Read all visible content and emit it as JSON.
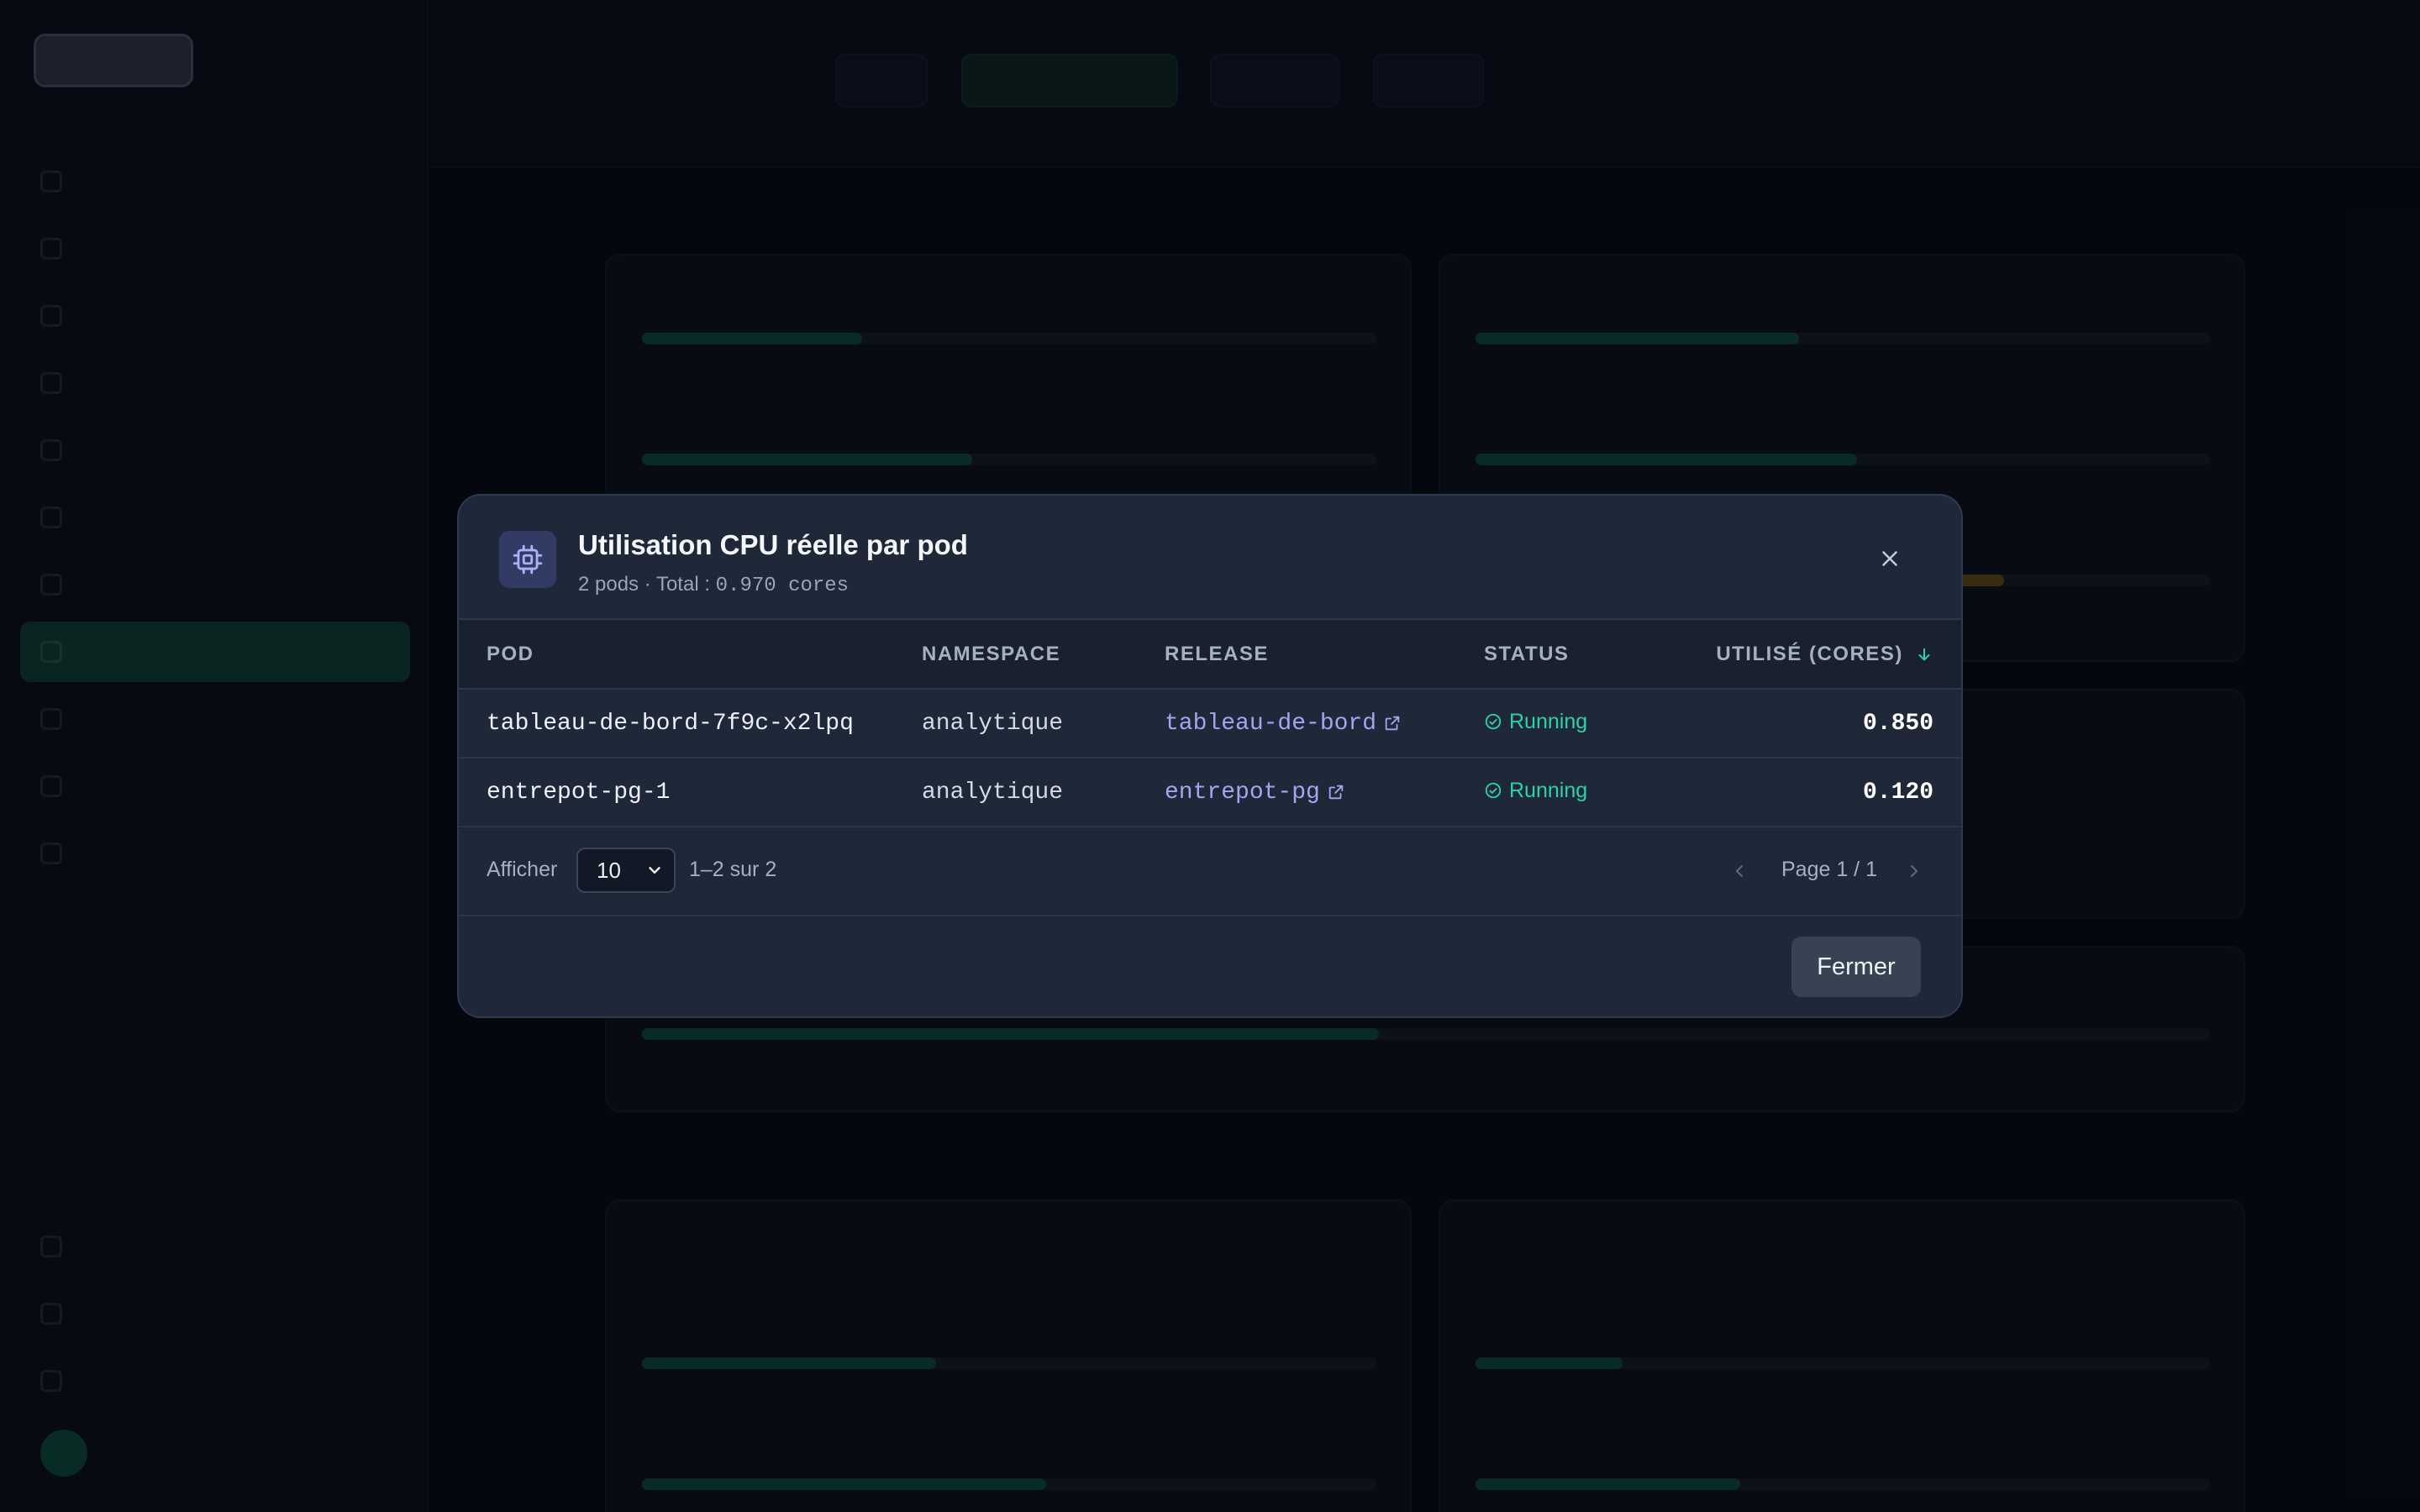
{
  "modal": {
    "title": "Utilisation CPU réelle par pod",
    "subtitle_prefix": "2 pods · Total : ",
    "subtitle_total": "0.970 cores",
    "columns": {
      "pod": "POD",
      "namespace": "NAMESPACE",
      "release": "RELEASE",
      "status": "STATUS",
      "used": "UTILISÉ (CORES)"
    },
    "rows": [
      {
        "pod": "tableau-de-bord-7f9c-x2lpq",
        "namespace": "analytique",
        "release": "tableau-de-bord",
        "status": "Running",
        "used": "0.850"
      },
      {
        "pod": "entrepot-pg-1",
        "namespace": "analytique",
        "release": "entrepot-pg",
        "status": "Running",
        "used": "0.120"
      }
    ],
    "pagination": {
      "show_label": "Afficher",
      "page_size": "10",
      "range": "1–2 sur 2",
      "page": "Page 1 / 1"
    },
    "close_button": "Fermer"
  },
  "icons": {
    "header": "cpu-icon",
    "close": "close-icon",
    "sort": "arrow-down-icon",
    "status": "check-circle-icon",
    "release_link": "external-link-icon"
  },
  "colors": {
    "accent": "#2fd1a6",
    "link": "#9fa7ee",
    "modal_bg": "#1e2838",
    "icon_tile": "#323b64"
  }
}
